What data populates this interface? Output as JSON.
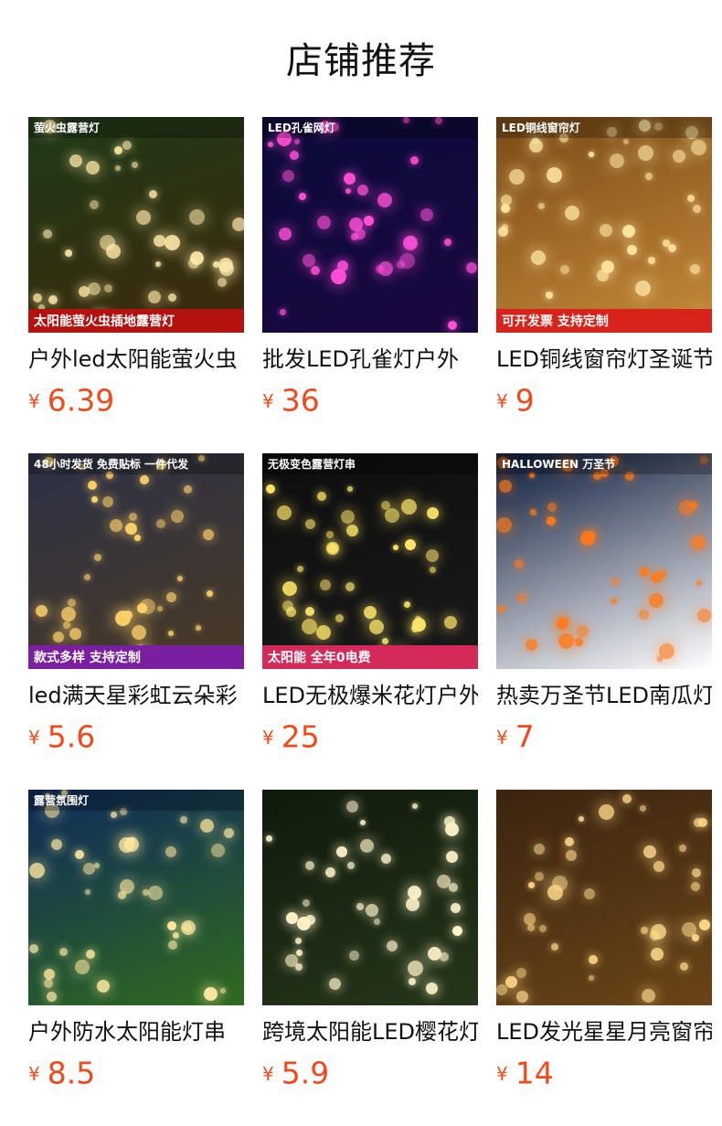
{
  "header": {
    "title": "店铺推荐"
  },
  "currency": "¥",
  "products": [
    {
      "name": "户外led太阳能萤火虫",
      "price": "6.39",
      "badge_top": "萤火虫露营灯",
      "badge_bottom": "太阳能萤火虫插地露营灯",
      "palette": {
        "bg1": "#1d3a18",
        "bg2": "#3f2a0c",
        "glow": "#ffe9a8",
        "band": "#b3120f"
      }
    },
    {
      "name": "批发LED孔雀灯户外",
      "price": "36",
      "badge_top": "LED孔雀网灯",
      "badge_bottom": "",
      "palette": {
        "bg1": "#0b0b3a",
        "bg2": "#1a0840",
        "glow": "#ff4fd8",
        "band": "#2d2dc8"
      }
    },
    {
      "name": "LED铜线窗帘灯圣诞节",
      "price": "9",
      "badge_top": "LED铜线窗帘灯",
      "badge_bottom": "可开发票 支持定制",
      "palette": {
        "bg1": "#7a4a16",
        "bg2": "#c58a3a",
        "glow": "#ffe6a0",
        "band": "#d8231b"
      }
    },
    {
      "name": "led满天星彩虹云朵彩",
      "price": "5.6",
      "badge_top": "48小时发货 免费贴标 一件代发",
      "badge_bottom": "款式多样 支持定制",
      "palette": {
        "bg1": "#2b3047",
        "bg2": "#4a3a24",
        "glow": "#ffd36b",
        "band": "#7a1fa0"
      }
    },
    {
      "name": "LED无极爆米花灯户外",
      "price": "25",
      "badge_top": "无极变色露营灯串",
      "badge_bottom": "太阳能 全年0电费",
      "palette": {
        "bg1": "#0d0d0d",
        "bg2": "#1a1a1a",
        "glow": "#ffe66a",
        "band": "#d42a5a"
      }
    },
    {
      "name": "热卖万圣节LED南瓜灯",
      "price": "7",
      "badge_top": "HALLOWEEN 万圣节",
      "badge_bottom": "",
      "palette": {
        "bg1": "#0b1a3a",
        "bg2": "#ffffff",
        "glow": "#ff7a1a",
        "band": "#0b1a3a"
      }
    },
    {
      "name": "户外防水太阳能灯串",
      "price": "8.5",
      "badge_top": "露营氛围灯",
      "badge_bottom": "",
      "palette": {
        "bg1": "#0e2a5c",
        "bg2": "#2f6b1e",
        "glow": "#ffe9a0",
        "band": "#0e2a5c"
      }
    },
    {
      "name": "跨境太阳能LED樱花灯",
      "price": "5.9",
      "badge_top": "",
      "badge_bottom": "",
      "palette": {
        "bg1": "#0f1a0c",
        "bg2": "#26361a",
        "glow": "#fff3c8",
        "band": "#0f1a0c"
      }
    },
    {
      "name": "LED发光星星月亮窗帘",
      "price": "14",
      "badge_top": "",
      "badge_bottom": "",
      "palette": {
        "bg1": "#3a2410",
        "bg2": "#6b4416",
        "glow": "#ffd88a",
        "band": "#3a2410"
      }
    }
  ]
}
